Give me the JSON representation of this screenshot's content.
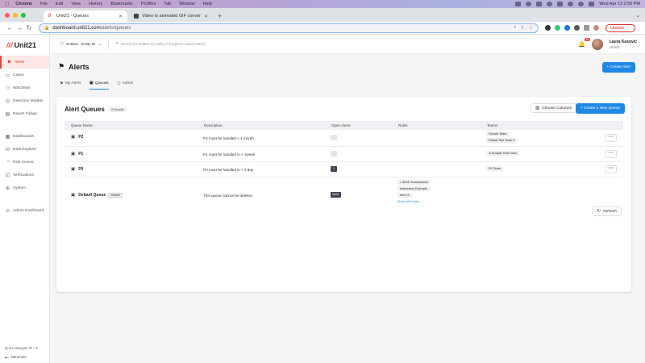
{
  "menubar": {
    "items": [
      "Chrome",
      "File",
      "Edit",
      "View",
      "History",
      "Bookmarks",
      "Profiles",
      "Tab",
      "Window",
      "Help"
    ],
    "clock": "Wed Apr 13  2:55 PM"
  },
  "browser": {
    "tabs": [
      {
        "label": "Unit21 - Queues",
        "active": true
      },
      {
        "label": "Video to animated GIF conver",
        "active": false
      }
    ],
    "url_host": "dashboard.unit21.com",
    "url_path": "/alerts/queues",
    "update_label": "Update"
  },
  "sidebar": {
    "logo": "Unit21",
    "items": [
      {
        "label": "Alerts",
        "icon": "flag-icon",
        "active": true
      },
      {
        "label": "Cases",
        "icon": "folder-icon"
      },
      {
        "label": "Watchlists",
        "icon": "users-icon"
      },
      {
        "label": "Detection Models",
        "icon": "radar-icon"
      },
      {
        "label": "Report Filings",
        "icon": "document-icon"
      },
      {
        "label": "Dashboards",
        "icon": "chart-icon"
      },
      {
        "label": "Data Explorer",
        "icon": "database-icon"
      },
      {
        "label": "Risk Scores",
        "icon": "gauge-icon"
      },
      {
        "label": "Verifications",
        "icon": "check-icon"
      },
      {
        "label": "System",
        "icon": "globe-icon"
      },
      {
        "label": "Admin Dashboard",
        "icon": "admin-icon"
      }
    ],
    "quick_navigate": "Quick Navigate  ⌘ + K",
    "minimize": "Minimize"
  },
  "topbar": {
    "entity_selector": "Entities - Entity ID",
    "search_placeholder": "Search for entities by entity id (requires exact match)",
    "notification_count": "16",
    "user_name": "Laura Kasovic",
    "user_org": "Unit21"
  },
  "page": {
    "title": "Alerts",
    "create_alert": "+ Create Alert",
    "tabs": [
      {
        "label": "My Alerts",
        "active": false
      },
      {
        "label": "Queues",
        "active": true
      },
      {
        "label": "Admin",
        "active": false
      }
    ]
  },
  "queues": {
    "title": "Alert Queues",
    "count": "4 Results",
    "choose_columns": "Choose Columns",
    "create_queue": "+ Create a New Queue",
    "columns": [
      "Queue Name",
      "Description",
      "Open Alerts",
      "Rules",
      "Teams"
    ],
    "rows": [
      {
        "name": "P2",
        "description": "P2 must be handled < 1 month",
        "open_alerts": "",
        "teams": [
          "Growth Team",
          "Global Test Team 2"
        ]
      },
      {
        "name": "P1",
        "description": "P1 must be handled in < 1week",
        "open_alerts": "",
        "teams": [
          "Jr Analyst Team new"
        ]
      },
      {
        "name": "P0",
        "description": "P0 must be handled in < 1 day",
        "open_alerts": "1",
        "teams": [
          "P0 Team"
        ]
      },
      {
        "name": "Default Queue",
        "default_tag": "Default",
        "description": "This queue cannot be deleted",
        "open_alerts": "9621",
        "rules": [
          "> $10K Transactions",
          "Instrument Example",
          "test V1"
        ],
        "show_all": "Show all 8 rules"
      }
    ],
    "refresh": "Refresh"
  },
  "colors": {
    "accent": "#1e88e5",
    "brand": "#e8423b"
  }
}
